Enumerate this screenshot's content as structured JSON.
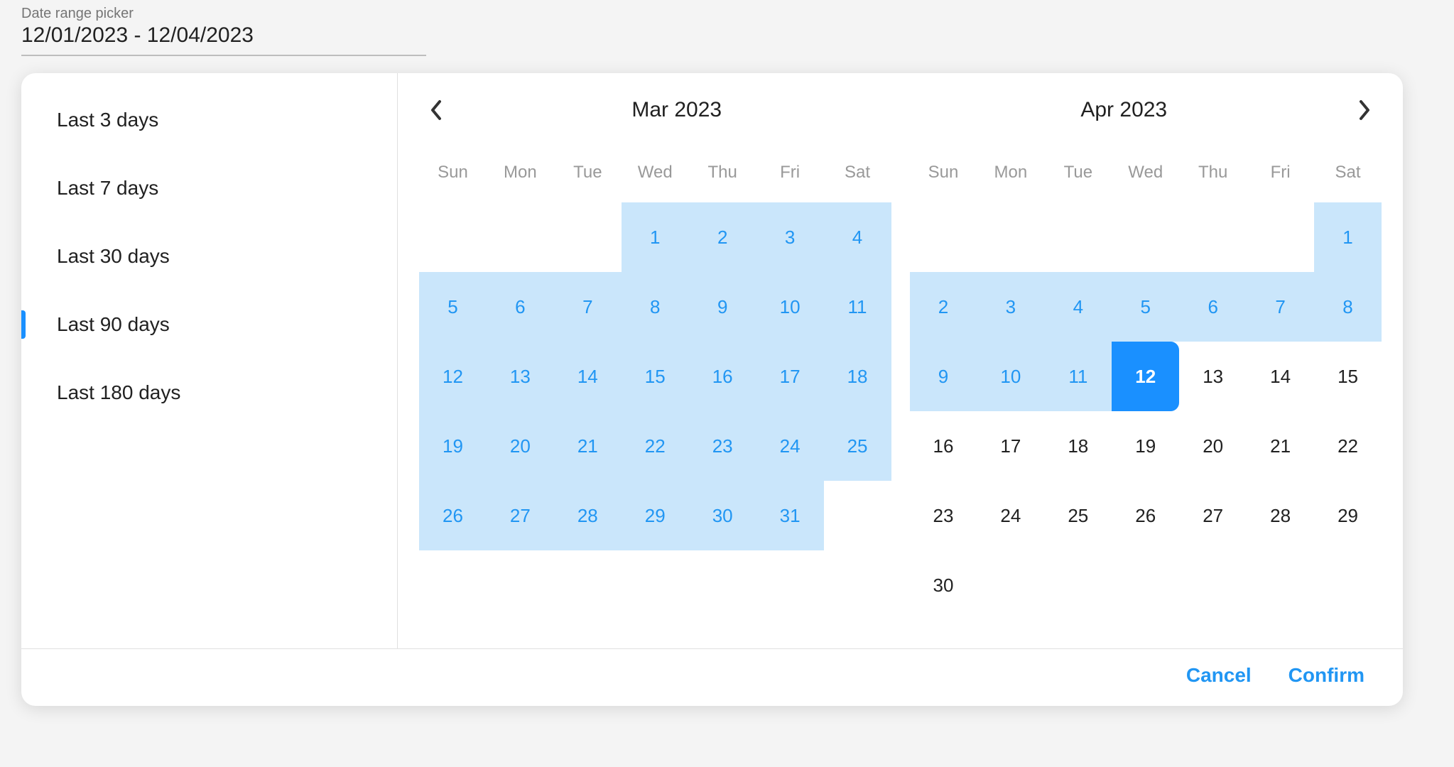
{
  "header": {
    "label": "Date range picker",
    "value": "12/01/2023 - 12/04/2023"
  },
  "presets": [
    {
      "label": "Last 3 days",
      "active": false
    },
    {
      "label": "Last 7 days",
      "active": false
    },
    {
      "label": "Last 30 days",
      "active": false
    },
    {
      "label": "Last 90 days",
      "active": true
    },
    {
      "label": "Last 180 days",
      "active": false
    }
  ],
  "weekdays": [
    "Sun",
    "Mon",
    "Tue",
    "Wed",
    "Thu",
    "Fri",
    "Sat"
  ],
  "months": [
    {
      "title": "Mar 2023",
      "offset": 3,
      "days": [
        {
          "n": 1,
          "s": "in"
        },
        {
          "n": 2,
          "s": "in"
        },
        {
          "n": 3,
          "s": "in"
        },
        {
          "n": 4,
          "s": "in"
        },
        {
          "n": 5,
          "s": "in"
        },
        {
          "n": 6,
          "s": "in"
        },
        {
          "n": 7,
          "s": "in"
        },
        {
          "n": 8,
          "s": "in"
        },
        {
          "n": 9,
          "s": "in"
        },
        {
          "n": 10,
          "s": "in"
        },
        {
          "n": 11,
          "s": "in"
        },
        {
          "n": 12,
          "s": "in"
        },
        {
          "n": 13,
          "s": "in"
        },
        {
          "n": 14,
          "s": "in"
        },
        {
          "n": 15,
          "s": "in"
        },
        {
          "n": 16,
          "s": "in"
        },
        {
          "n": 17,
          "s": "in"
        },
        {
          "n": 18,
          "s": "in"
        },
        {
          "n": 19,
          "s": "in"
        },
        {
          "n": 20,
          "s": "in"
        },
        {
          "n": 21,
          "s": "in"
        },
        {
          "n": 22,
          "s": "in"
        },
        {
          "n": 23,
          "s": "in"
        },
        {
          "n": 24,
          "s": "in"
        },
        {
          "n": 25,
          "s": "in"
        },
        {
          "n": 26,
          "s": "in"
        },
        {
          "n": 27,
          "s": "in"
        },
        {
          "n": 28,
          "s": "in"
        },
        {
          "n": 29,
          "s": "in"
        },
        {
          "n": 30,
          "s": "in"
        },
        {
          "n": 31,
          "s": "in"
        }
      ]
    },
    {
      "title": "Apr 2023",
      "offset": 6,
      "days": [
        {
          "n": 1,
          "s": "in"
        },
        {
          "n": 2,
          "s": "in"
        },
        {
          "n": 3,
          "s": "in"
        },
        {
          "n": 4,
          "s": "in"
        },
        {
          "n": 5,
          "s": "in"
        },
        {
          "n": 6,
          "s": "in"
        },
        {
          "n": 7,
          "s": "in"
        },
        {
          "n": 8,
          "s": "in"
        },
        {
          "n": 9,
          "s": "in"
        },
        {
          "n": 10,
          "s": "in"
        },
        {
          "n": 11,
          "s": "in"
        },
        {
          "n": 12,
          "s": "sel"
        },
        {
          "n": 13,
          "s": "out"
        },
        {
          "n": 14,
          "s": "out"
        },
        {
          "n": 15,
          "s": "out"
        },
        {
          "n": 16,
          "s": "out"
        },
        {
          "n": 17,
          "s": "out"
        },
        {
          "n": 18,
          "s": "out"
        },
        {
          "n": 19,
          "s": "out"
        },
        {
          "n": 20,
          "s": "out"
        },
        {
          "n": 21,
          "s": "out"
        },
        {
          "n": 22,
          "s": "out"
        },
        {
          "n": 23,
          "s": "out"
        },
        {
          "n": 24,
          "s": "out"
        },
        {
          "n": 25,
          "s": "out"
        },
        {
          "n": 26,
          "s": "out"
        },
        {
          "n": 27,
          "s": "out"
        },
        {
          "n": 28,
          "s": "out"
        },
        {
          "n": 29,
          "s": "out"
        },
        {
          "n": 30,
          "s": "out"
        }
      ]
    }
  ],
  "footer": {
    "cancel": "Cancel",
    "confirm": "Confirm"
  }
}
